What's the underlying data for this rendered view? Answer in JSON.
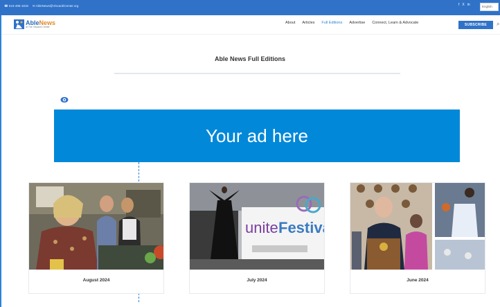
{
  "topbar": {
    "phone": "☎ 516-485-1818",
    "email": "✉ AbleNews@ViscardiCenter.org",
    "social": [
      "f",
      "X",
      "in"
    ],
    "language": "English"
  },
  "logo": {
    "brand_part1": "Able",
    "brand_part2": "News",
    "tagline": "at The Viscardi Center"
  },
  "nav": {
    "items": [
      "About",
      "Articles",
      "Full Editions",
      "Advertise",
      "Connect, Learn & Advocate"
    ],
    "active": "Full Editions",
    "subscribe": "SUBSCRIBE"
  },
  "page": {
    "title": "Able News Full Editions"
  },
  "ad": {
    "text": "Your ad here"
  },
  "editions": [
    {
      "label": "August 2024"
    },
    {
      "label": "July 2024"
    },
    {
      "label": "June 2024"
    }
  ],
  "colors": {
    "brand_blue": "#2f72c8",
    "ad_blue": "#0288d9",
    "active_link": "#2a84d6"
  },
  "icons": [
    "phone-icon",
    "mail-icon",
    "facebook-icon",
    "x-icon",
    "linkedin-icon",
    "search-icon",
    "eye-icon"
  ]
}
